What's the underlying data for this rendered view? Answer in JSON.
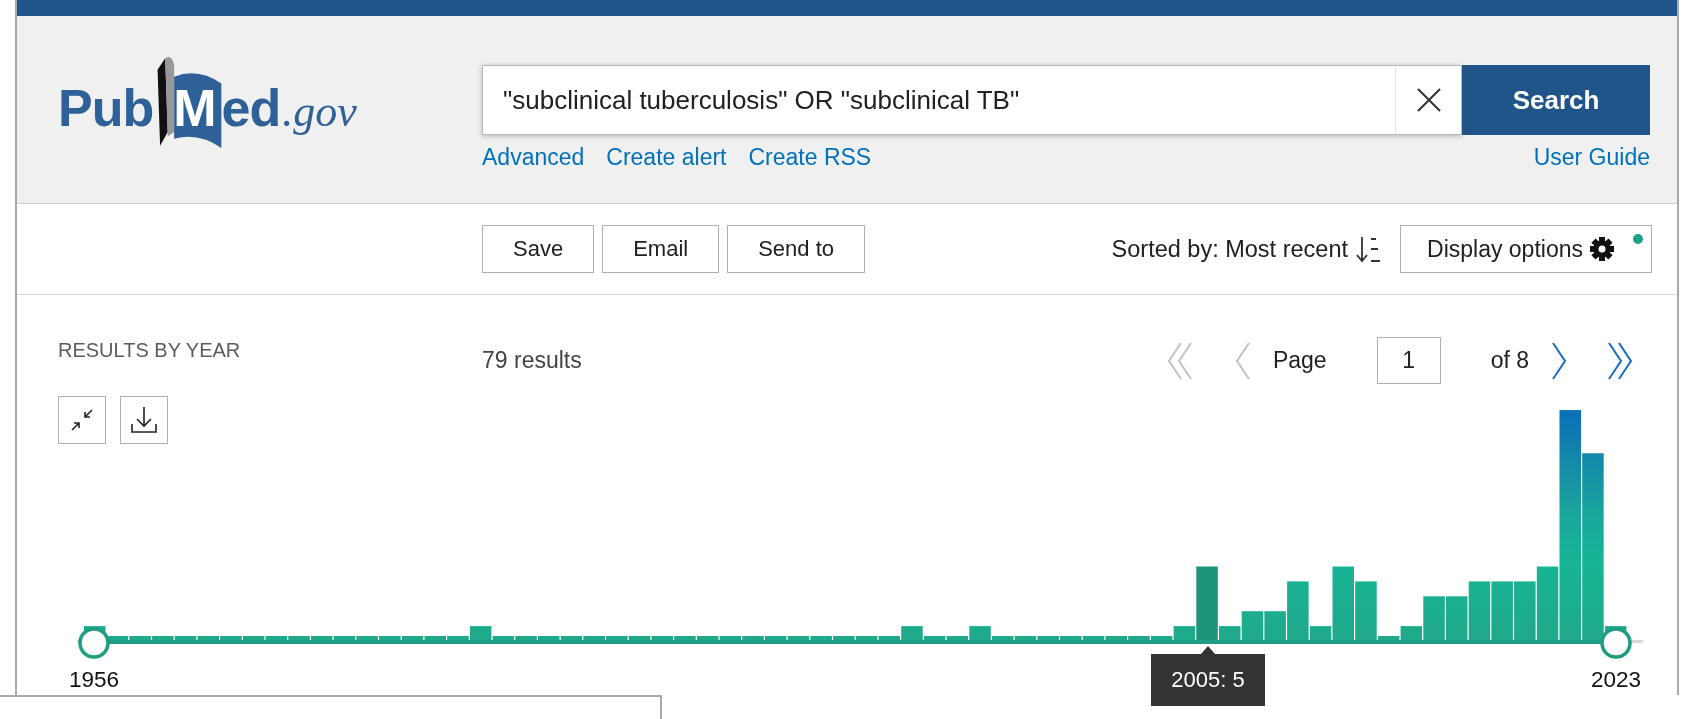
{
  "logo": {
    "parts": [
      {
        "text": "Pub",
        "kind": "plain"
      },
      {
        "text": "M",
        "kind": "book"
      },
      {
        "text": "ed",
        "kind": "plain"
      },
      {
        "text": ".gov",
        "kind": "suffix"
      }
    ]
  },
  "search": {
    "value": "\"subclinical tuberculosis\" OR \"subclinical TB\"",
    "button": "Search"
  },
  "search_links": [
    "Advanced",
    "Create alert",
    "Create RSS"
  ],
  "user_guide": "User Guide",
  "actions": [
    "Save",
    "Email",
    "Send to"
  ],
  "sort": {
    "label": "Sorted by: Most recent"
  },
  "display_options": {
    "label": "Display options",
    "modified": true
  },
  "results_by_year": {
    "title": "RESULTS BY YEAR",
    "start_year": "1956",
    "end_year": "2023",
    "tooltip": "2005: 5"
  },
  "results_count": "79 results",
  "pagination": {
    "first": {
      "disabled": true
    },
    "previous": {
      "disabled": true
    },
    "label": "Page",
    "page": "1",
    "total": "of 8",
    "next": {
      "disabled": false
    },
    "last": {
      "disabled": false
    }
  }
}
